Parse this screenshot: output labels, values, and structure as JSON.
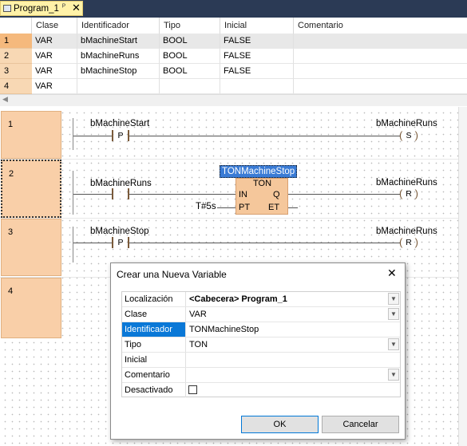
{
  "tab": {
    "title": "Program_1",
    "pin": "ᴾ",
    "close": "✕"
  },
  "grid": {
    "headers": [
      "Clase",
      "Identificador",
      "Tipo",
      "Inicial",
      "Comentario"
    ],
    "rows": [
      {
        "n": "1",
        "clase": "VAR",
        "id": "bMachineStart",
        "tipo": "BOOL",
        "inicial": "FALSE"
      },
      {
        "n": "2",
        "clase": "VAR",
        "id": "bMachineRuns",
        "tipo": "BOOL",
        "inicial": "FALSE"
      },
      {
        "n": "3",
        "clase": "VAR",
        "id": "bMachineStop",
        "tipo": "BOOL",
        "inicial": "FALSE"
      },
      {
        "n": "4",
        "clase": "VAR",
        "id": "",
        "tipo": "",
        "inicial": ""
      }
    ],
    "scroll_arrow": "◀"
  },
  "ladder": {
    "rungs": [
      "1",
      "2",
      "3",
      "4"
    ],
    "r1": {
      "contact_var": "bMachineStart",
      "contact_type": "P",
      "coil_var": "bMachineRuns",
      "coil_type": "S"
    },
    "r2": {
      "contact_var": "bMachineRuns",
      "fb_instance": "TONMachineStop",
      "fb_type": "TON",
      "in": "IN",
      "pt": "PT",
      "q": "Q",
      "et": "ET",
      "pt_value": "T#5s",
      "coil_var": "bMachineRuns",
      "coil_type": "R"
    },
    "r3": {
      "contact_var": "bMachineStop",
      "contact_type": "P",
      "coil_var": "bMachineRuns",
      "coil_type": "R"
    }
  },
  "dialog": {
    "title": "Crear una Nueva Variable",
    "close": "✕",
    "fields": {
      "localizacion": {
        "label": "Localización",
        "value": "<Cabecera> Program_1"
      },
      "clase": {
        "label": "Clase",
        "value": "VAR"
      },
      "identificador": {
        "label": "Identificador",
        "value": "TONMachineStop"
      },
      "tipo": {
        "label": "Tipo",
        "value": "TON"
      },
      "inicial": {
        "label": "Inicial",
        "value": ""
      },
      "comentario": {
        "label": "Comentario",
        "value": ""
      },
      "desactivado": {
        "label": "Desactivado",
        "checked": false
      }
    },
    "ok": "OK",
    "cancel": "Cancelar"
  },
  "colors": {
    "tab_bg": "#fff2a8",
    "rung_bg": "#f9cfa8",
    "fb_bg": "#f5c79b",
    "selection": "#0a78d7"
  }
}
